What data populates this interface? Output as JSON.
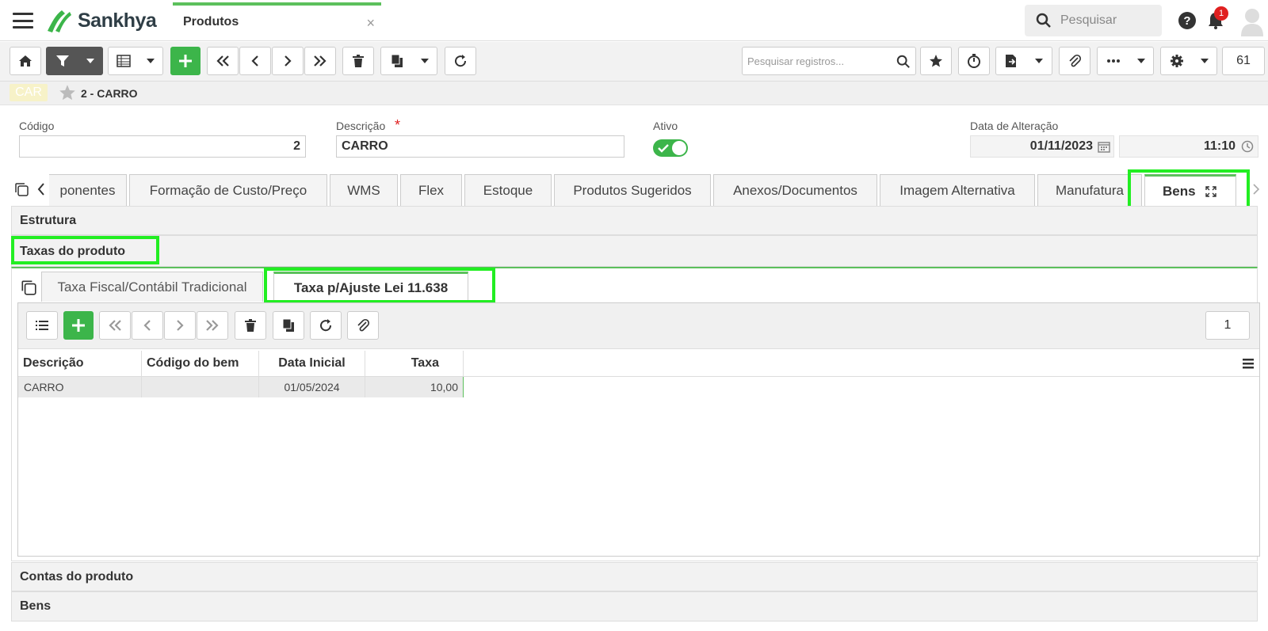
{
  "app": {
    "brand": "Sankhya",
    "tab_title": "Produtos",
    "tab_close": "×",
    "search_placeholder": "Pesquisar",
    "notification_count": "1"
  },
  "toolbar": {
    "records_placeholder": "Pesquisar registros...",
    "page_counter": "61"
  },
  "record": {
    "badge": "CAR",
    "title": "2 - CARRO"
  },
  "form": {
    "codigo_label": "Código",
    "codigo_value": "2",
    "descricao_label": "Descrição",
    "descricao_required": "*",
    "descricao_value": "CARRO",
    "ativo_label": "Ativo",
    "ativo_value": true,
    "data_alteracao_label": "Data de Alteração",
    "data_value": "01/11/2023",
    "hora_value": "11:10"
  },
  "main_tabs": [
    {
      "label": "ponentes"
    },
    {
      "label": "Formação de Custo/Preço"
    },
    {
      "label": "WMS"
    },
    {
      "label": "Flex"
    },
    {
      "label": "Estoque"
    },
    {
      "label": "Produtos Sugeridos"
    },
    {
      "label": "Anexos/Documentos"
    },
    {
      "label": "Imagem Alternativa"
    },
    {
      "label": "Manufatura"
    },
    {
      "label": "Bens",
      "active": true
    }
  ],
  "sections": {
    "estrutura": "Estrutura",
    "taxas": "Taxas do produto",
    "contas": "Contas do produto",
    "bens": "Bens"
  },
  "sub_tabs": [
    {
      "label": "Taxa Fiscal/Contábil Tradicional"
    },
    {
      "label": "Taxa p/Ajuste Lei 11.638",
      "active": true
    }
  ],
  "grid": {
    "counter": "1",
    "columns": [
      "Descrição",
      "Código do bem",
      "Data Inicial",
      "Taxa"
    ],
    "rows": [
      {
        "descricao": "CARRO",
        "codigo_bem": "",
        "data_inicial": "01/05/2024",
        "taxa": "10,00"
      }
    ]
  },
  "colors": {
    "accent": "#3cb54a",
    "highlight": "#22ee22",
    "toolbar_dark": "#555555"
  }
}
